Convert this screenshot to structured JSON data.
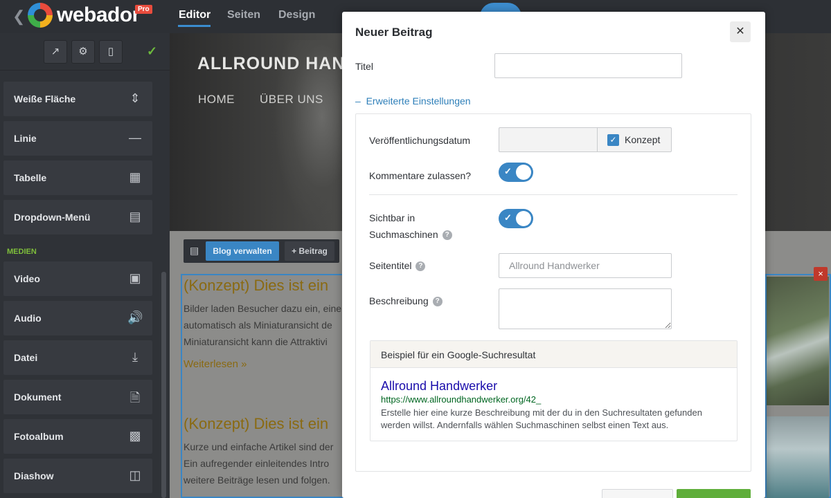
{
  "topbar": {
    "brand": "webador",
    "badge": "Pro",
    "tabs": [
      {
        "label": "Editor"
      },
      {
        "label": "Seiten"
      },
      {
        "label": "Design"
      }
    ]
  },
  "sidebar": {
    "items_top": [
      {
        "label": "Weiße Fläche",
        "icon": "spacer-icon"
      },
      {
        "label": "Linie",
        "icon": "minus-icon"
      },
      {
        "label": "Tabelle",
        "icon": "table-icon"
      },
      {
        "label": "Dropdown-Menü",
        "icon": "dropdown-icon"
      }
    ],
    "section_heading": "MEDIEN",
    "items_media": [
      {
        "label": "Video",
        "icon": "film-icon"
      },
      {
        "label": "Audio",
        "icon": "speaker-icon"
      },
      {
        "label": "Datei",
        "icon": "download-icon"
      },
      {
        "label": "Dokument",
        "icon": "document-icon"
      },
      {
        "label": "Fotoalbum",
        "icon": "grid-icon"
      },
      {
        "label": "Diashow",
        "icon": "slideshow-icon"
      }
    ]
  },
  "site": {
    "title": "ALLROUND HAN",
    "nav": [
      "HOME",
      "ÜBER UNS"
    ],
    "blog_toolbar": {
      "manage": "Blog verwalten",
      "add": "+ Beitrag"
    },
    "posts": [
      {
        "title": "(Konzept) Dies ist ein",
        "lines": [
          "Bilder laden Besucher dazu ein, eine",
          "automatisch als Miniaturansicht de",
          "Miniaturansicht kann die Attraktivi"
        ],
        "read_more": "Weiterlesen »"
      },
      {
        "title": "(Konzept) Dies ist ein",
        "lines": [
          "Kurze und einfache Artikel sind der",
          "Ein aufregender einleitendes Intro",
          "weitere Beiträge lesen und folgen."
        ]
      }
    ],
    "gallery_close": "×"
  },
  "modal": {
    "title": "Neuer Beitrag",
    "close": "✕",
    "titel_label": "Titel",
    "titel_value": "",
    "advanced_link": "Erweiterte Einstellungen",
    "advanced_toggle": "–",
    "date_label": "Veröffentlichungsdatum",
    "draft_label": "Konzept",
    "draft_checked": true,
    "comments_label": "Kommentare zulassen?",
    "comments_enabled": true,
    "search_visible_label_1": "Sichtbar in",
    "search_visible_label_2": "Suchmaschinen",
    "search_visible_enabled": true,
    "page_title_label": "Seitentitel",
    "page_title_placeholder": "Allround Handwerker",
    "description_label": "Beschreibung",
    "description_value": "",
    "help": "?",
    "preview": {
      "heading": "Beispiel für ein Google-Suchresultat",
      "g_title": "Allround Handwerker",
      "g_url": "https://www.allroundhandwerker.org/42_",
      "g_desc": "Erstelle hier eine kurze Beschreibung mit der du in den Suchresultaten gefunden werden willst. Andernfalls wählen Suchmaschinen selbst einen Text aus."
    }
  },
  "colors": {
    "accent": "#3a86c4",
    "save": "#5fae3a",
    "google_title": "#1a0dab",
    "google_url": "#006621"
  }
}
